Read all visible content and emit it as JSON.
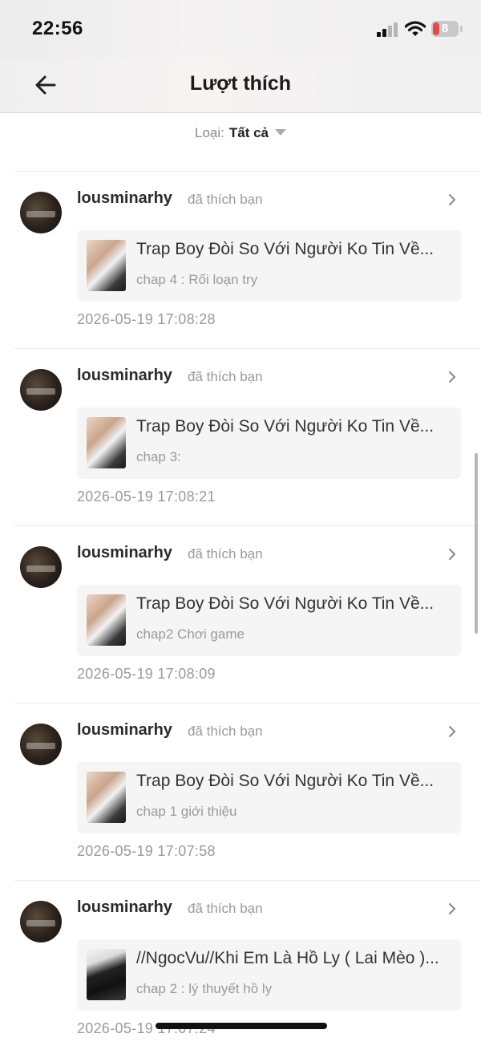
{
  "status_bar": {
    "time": "22:56",
    "battery": "8"
  },
  "header": {
    "title": "Lượt thích",
    "back_icon": "arrow-left-icon"
  },
  "filter": {
    "label": "Loại:",
    "value": "Tất cả"
  },
  "items": [
    {
      "user": "lousminarhy",
      "action": "đã thích bạn",
      "story_title": "Trap Boy Đòi So Với Người Ko Tin Về...",
      "chapter": "chap 4 : Rối loạn try",
      "timestamp": "2026-05-19 17:08:28"
    },
    {
      "user": "lousminarhy",
      "action": "đã thích bạn",
      "story_title": "Trap Boy Đòi So Với Người Ko Tin Về...",
      "chapter": "chap 3:",
      "timestamp": "2026-05-19 17:08:21"
    },
    {
      "user": "lousminarhy",
      "action": "đã thích bạn",
      "story_title": "Trap Boy Đòi So Với Người Ko Tin Về...",
      "chapter": "chap2 Chơi game",
      "timestamp": "2026-05-19 17:08:09"
    },
    {
      "user": "lousminarhy",
      "action": "đã thích bạn",
      "story_title": "Trap Boy Đòi So Với Người Ko Tin Về...",
      "chapter": "chap 1 giới thiệu",
      "timestamp": "2026-05-19 17:07:58"
    },
    {
      "user": "lousminarhy",
      "action": "đã thích bạn",
      "story_title": "//NgocVu//Khi Em Là Hồ Ly ( Lai Mèo )...",
      "chapter": "chap 2 : lý thuyết hồ ly",
      "timestamp": "2026-05-19 17:07:24"
    }
  ]
}
